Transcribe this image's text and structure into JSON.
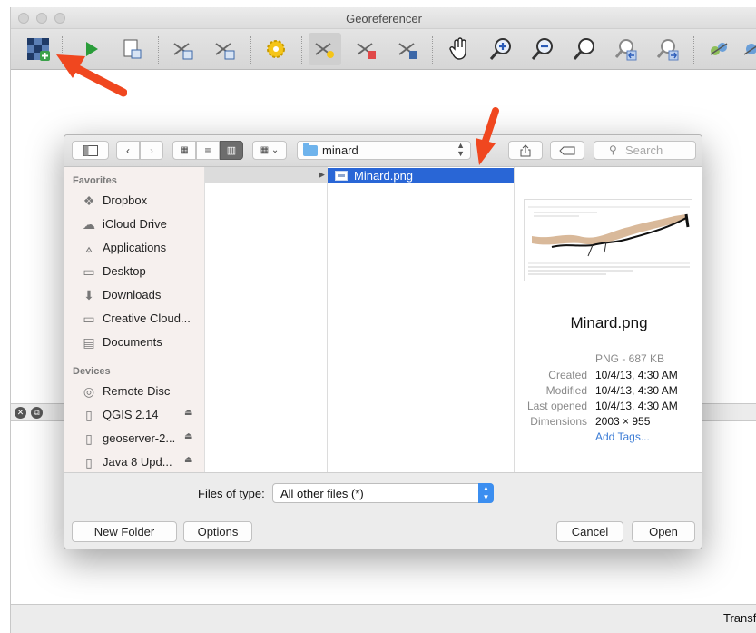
{
  "window": {
    "title": "Georeferencer"
  },
  "statusbar": {
    "text": "Transf"
  },
  "toolbar": {
    "icons": [
      "open-raster-icon",
      "start-georeferencing-icon",
      "generate-script-icon",
      "load-gcp-icon",
      "save-gcp-icon",
      "settings-icon",
      "add-point-icon",
      "delete-point-icon",
      "move-point-icon",
      "pan-icon",
      "zoom-in-icon",
      "zoom-out-icon",
      "zoom-full-icon",
      "zoom-last-icon",
      "zoom-next-icon",
      "link-icon"
    ]
  },
  "dialog": {
    "location": "minard",
    "search_placeholder": "Search",
    "sidebar": {
      "favorites_header": "Favorites",
      "favorites": [
        {
          "label": "Dropbox",
          "icon": "dropbox-icon"
        },
        {
          "label": "iCloud Drive",
          "icon": "cloud-icon"
        },
        {
          "label": "Applications",
          "icon": "applications-icon"
        },
        {
          "label": "Desktop",
          "icon": "desktop-icon"
        },
        {
          "label": "Downloads",
          "icon": "downloads-icon"
        },
        {
          "label": "Creative Cloud...",
          "icon": "folder-icon"
        },
        {
          "label": "Documents",
          "icon": "documents-icon"
        }
      ],
      "devices_header": "Devices",
      "devices": [
        {
          "label": "Remote Disc",
          "icon": "disc-icon"
        },
        {
          "label": "QGIS 2.14",
          "icon": "drive-icon",
          "eject": "⏏"
        },
        {
          "label": "geoserver-2...",
          "icon": "drive-icon",
          "eject": "⏏"
        },
        {
          "label": "Java 8 Upd...",
          "icon": "drive-icon",
          "eject": "⏏"
        }
      ]
    },
    "selected_file": "Minard.png",
    "preview": {
      "name": "Minard.png",
      "kind": "PNG - 687 KB",
      "created_label": "Created",
      "created": "10/4/13, 4:30 AM",
      "modified_label": "Modified",
      "modified": "10/4/13, 4:30 AM",
      "last_opened_label": "Last opened",
      "last_opened": "10/4/13, 4:30 AM",
      "dimensions_label": "Dimensions",
      "dimensions": "2003 × 955",
      "add_tags": "Add Tags..."
    },
    "file_type_label": "Files of type:",
    "file_type_value": "All other files (*)",
    "new_folder": "New Folder",
    "options": "Options",
    "cancel": "Cancel",
    "open": "Open"
  },
  "colors": {
    "selection": "#2966d6",
    "annotation_arrow": "#f0471f",
    "link": "#3a7bd5"
  }
}
